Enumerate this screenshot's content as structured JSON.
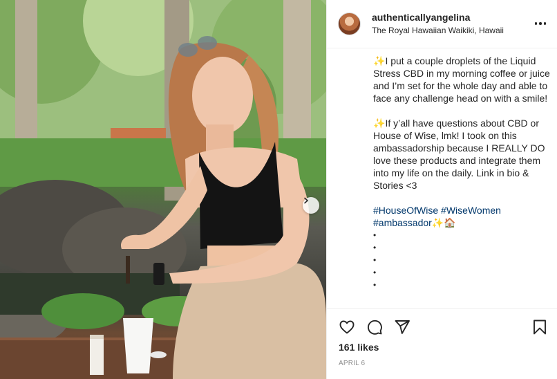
{
  "post": {
    "username": "authenticallyangelina",
    "location": "The Royal Hawaiian Waikiki, Hawaii",
    "caption": {
      "paragraph1": "I put a couple droplets of the Liquid Stress CBD in my morning coffee or juice and I’m set for the whole day and able to face any challenge head on with a smile!",
      "paragraph2": "If y’all have questions about CBD or House of Wise, lmk! I took on this ambassadorship because I REALLY DO love these products and integrate them into my life on the daily. Link in bio & Stories <3",
      "hashtags": [
        "#HouseOfWise",
        "#WiseWomen",
        "#ambassador"
      ],
      "dots": [
        "•",
        "•",
        "•",
        "•",
        "•"
      ],
      "sparkle": "✨",
      "house_emoji": "🏠"
    },
    "likes": "161 likes",
    "date": "APRIL 6"
  },
  "icons": {
    "more": "more-horizontal-icon",
    "like": "heart-icon",
    "comment": "comment-icon",
    "share": "share-icon",
    "save": "bookmark-icon",
    "carousel_next": "chevron-right-icon"
  },
  "colors": {
    "text": "#262626",
    "hashtag": "#00376b",
    "secondary": "#8e8e8e",
    "divider": "#efefef"
  }
}
